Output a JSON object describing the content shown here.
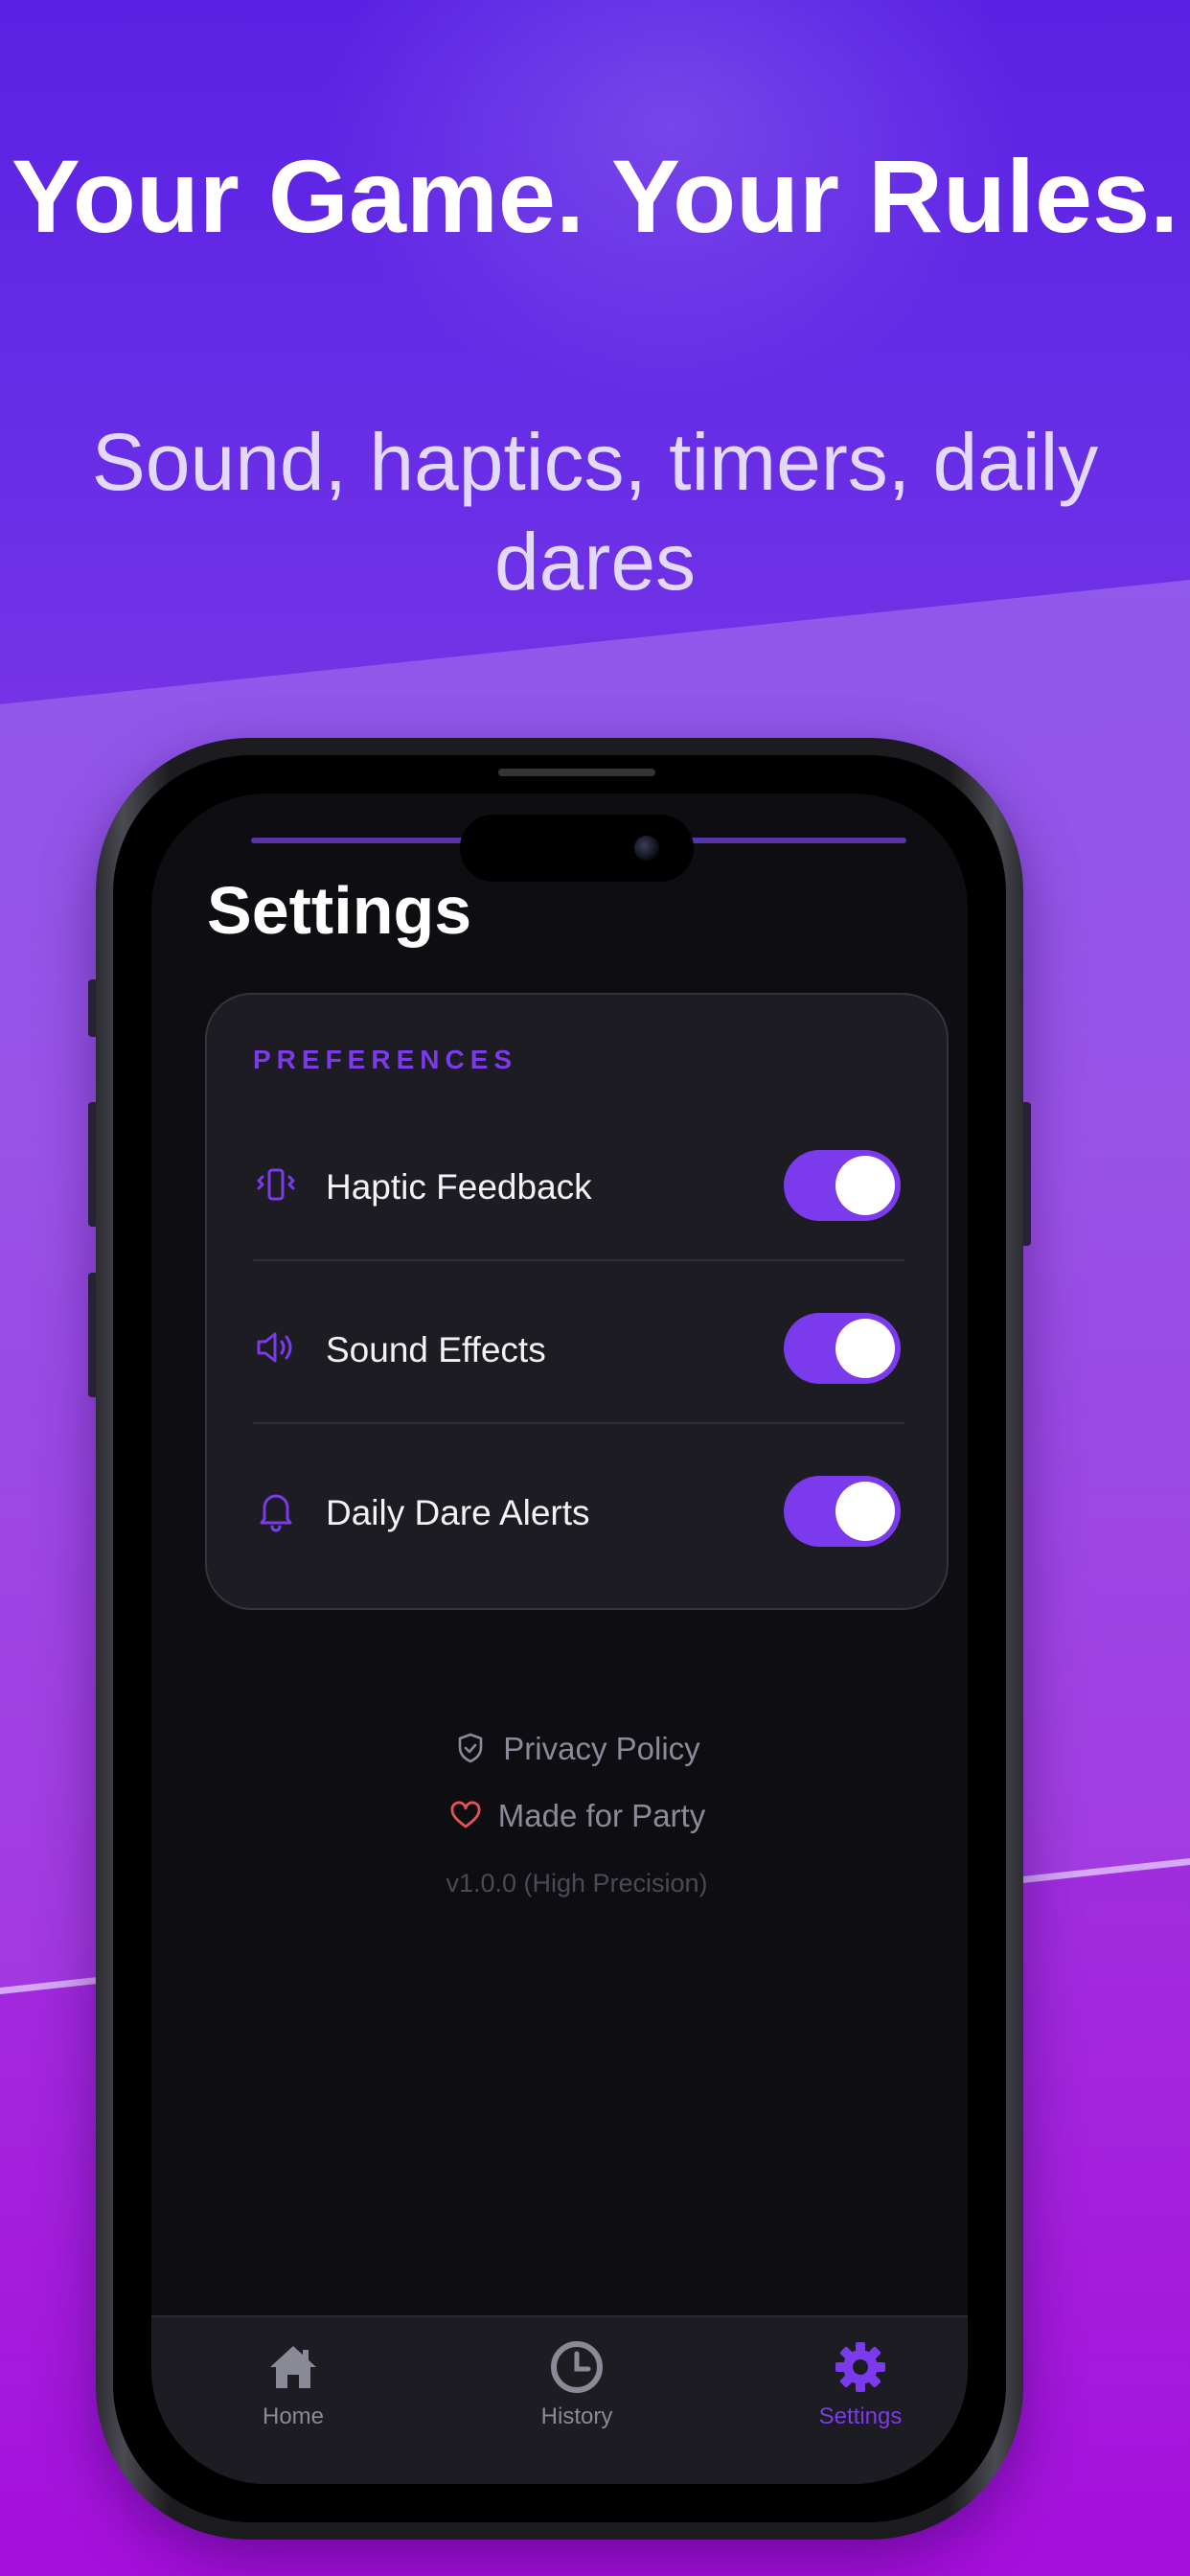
{
  "headline": "Your Game. Your Rules.",
  "subheadline": "Sound, haptics, timers, daily dares",
  "screen": {
    "title": "Settings",
    "preferences": {
      "section_label": "PREFERENCES",
      "items": [
        {
          "label": "Haptic Feedback",
          "icon": "vibration-icon",
          "enabled": true
        },
        {
          "label": "Sound Effects",
          "icon": "speaker-icon",
          "enabled": true
        },
        {
          "label": "Daily Dare Alerts",
          "icon": "bell-icon",
          "enabled": true
        }
      ]
    },
    "links": {
      "privacy": "Privacy Policy",
      "made_for": "Made for Party"
    },
    "version": "v1.0.0 (High Precision)",
    "tabs": [
      {
        "label": "Home",
        "icon": "home-icon",
        "active": false
      },
      {
        "label": "History",
        "icon": "clock-icon",
        "active": false
      },
      {
        "label": "Settings",
        "icon": "gear-icon",
        "active": true
      }
    ]
  },
  "colors": {
    "accent": "#7c3aed",
    "heart": "#e25555",
    "screen_bg": "#0e0e12",
    "card_bg": "#1c1c22"
  }
}
